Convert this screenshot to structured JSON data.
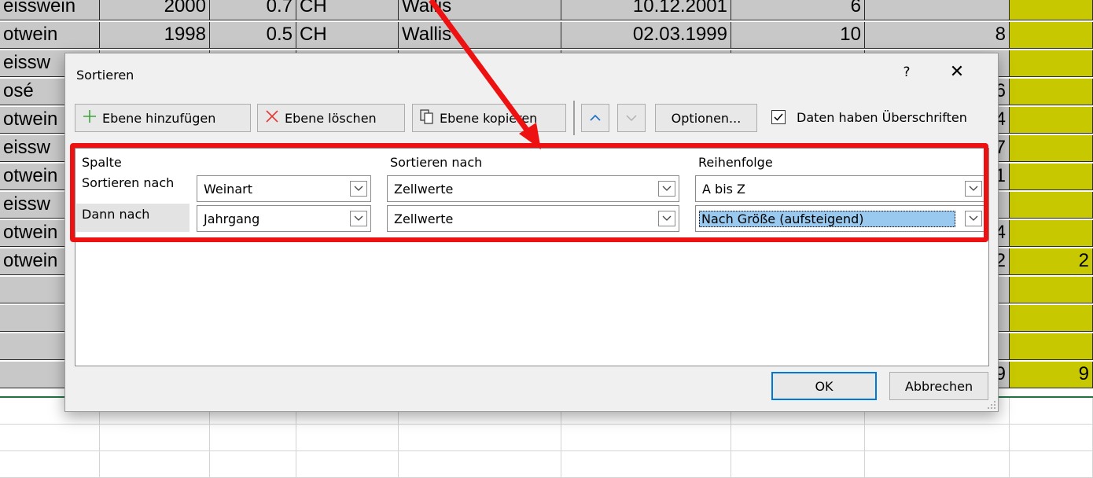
{
  "sheet": {
    "rows": [
      {
        "a": "eisswein",
        "b": "2000",
        "c": "0.7",
        "d": "CH",
        "e": "Wallis",
        "f": "10.12.2001",
        "g": "6",
        "h": "",
        "i": ""
      },
      {
        "a": "otwein",
        "b": "1998",
        "c": "0.5",
        "d": "CH",
        "e": "Wallis",
        "f": "02.03.1999",
        "g": "10",
        "h": "8",
        "i": ""
      },
      {
        "a": "eissw",
        "b": "",
        "c": "",
        "d": "",
        "e": "",
        "f": "",
        "g": "",
        "h": "",
        "i": ""
      },
      {
        "a": "osé",
        "b": "",
        "c": "",
        "d": "",
        "e": "",
        "f": "",
        "g": "",
        "h": "6",
        "i": ""
      },
      {
        "a": "otwein",
        "b": "",
        "c": "",
        "d": "",
        "e": "",
        "f": "",
        "g": "",
        "h": "4",
        "i": ""
      },
      {
        "a": "eissw",
        "b": "",
        "c": "",
        "d": "",
        "e": "",
        "f": "",
        "g": "",
        "h": "7",
        "i": ""
      },
      {
        "a": "otwein",
        "b": "",
        "c": "",
        "d": "",
        "e": "",
        "f": "",
        "g": "",
        "h": "1",
        "i": ""
      },
      {
        "a": "eissw",
        "b": "",
        "c": "",
        "d": "",
        "e": "",
        "f": "",
        "g": "",
        "h": "",
        "i": ""
      },
      {
        "a": "otwein",
        "b": "",
        "c": "",
        "d": "",
        "e": "",
        "f": "",
        "g": "",
        "h": "4",
        "i": ""
      },
      {
        "a": "otwein",
        "b": "",
        "c": "",
        "d": "",
        "e": "",
        "f": "",
        "g": "",
        "h": "2",
        "i": "2"
      },
      {
        "a": "",
        "b": "",
        "c": "",
        "d": "",
        "e": "",
        "f": "",
        "g": "",
        "h": "",
        "i": ""
      },
      {
        "a": "",
        "b": "",
        "c": "",
        "d": "",
        "e": "",
        "f": "",
        "g": "",
        "h": "",
        "i": ""
      },
      {
        "a": "",
        "b": "",
        "c": "",
        "d": "",
        "e": "",
        "f": "",
        "g": "",
        "h": "",
        "i": ""
      },
      {
        "a": "",
        "b": "",
        "c": "",
        "d": "",
        "e": "",
        "f": "",
        "g": "",
        "h": "9",
        "i": "9"
      }
    ]
  },
  "dialog": {
    "title": "Sortieren",
    "help": "?",
    "close": "✕",
    "toolbar": {
      "add_level": "Ebene hinzufügen",
      "delete_level": "Ebene löschen",
      "copy_level": "Ebene kopieren",
      "options": "Optionen...",
      "has_headers": "Daten haben Überschriften",
      "has_headers_checked": true
    },
    "headers": {
      "column": "Spalte",
      "sort_on": "Sortieren nach",
      "order": "Reihenfolge"
    },
    "levels": [
      {
        "label": "Sortieren nach",
        "column": "Weinart",
        "sort_on": "Zellwerte",
        "order": "A bis Z"
      },
      {
        "label": "Dann nach",
        "column": "Jahrgang",
        "sort_on": "Zellwerte",
        "order": "Nach Größe (aufsteigend)"
      }
    ],
    "ok": "OK",
    "cancel": "Abbrechen"
  },
  "colors": {
    "annotation_red": "#ee1111",
    "cell_gray": "#c8c8c8",
    "cell_yellow": "#c8c800",
    "selection_blue": "#99c9ef",
    "ok_border": "#0078d7"
  }
}
